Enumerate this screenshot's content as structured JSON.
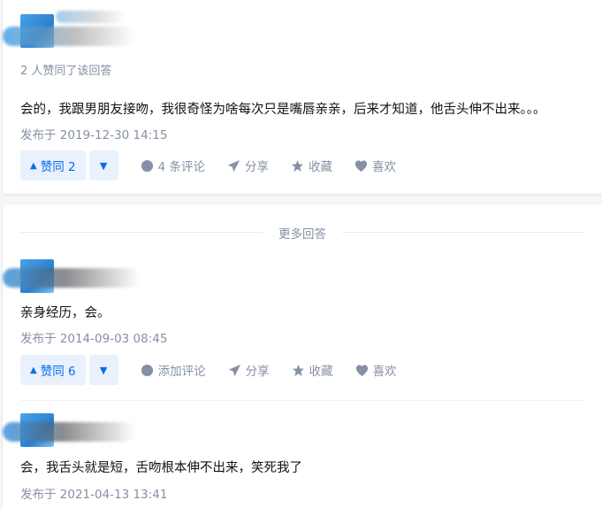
{
  "answers": [
    {
      "votes_note": "2 人赞同了该回答",
      "text": "会的，我跟男朋友接吻，我很奇怪为啥每次只是嘴唇亲亲，后来才知道，他舌头伸不出来。。。",
      "date": "发布于 2019-12-30 14:15",
      "upvote_label": "赞同 2",
      "comment_label": "4 条评论"
    },
    {
      "text": "亲身经历，会。",
      "date": "发布于 2014-09-03 08:45",
      "upvote_label": "赞同 6",
      "comment_label": "添加评论"
    },
    {
      "text": "会，我舌头就是短，舌吻根本伸不出来，笑死我了",
      "date": "发布于 2021-04-13 13:41"
    }
  ],
  "actions": {
    "share": "分享",
    "favorite": "收藏",
    "like": "喜欢",
    "up_arrow": "▲",
    "down_arrow": "▼"
  },
  "more_answers_label": "更多回答",
  "icons": [
    "comment-icon",
    "share-icon",
    "star-icon",
    "heart-icon"
  ],
  "colors": {
    "accent": "#056de8",
    "accent_bg": "#e9f1fd",
    "muted": "#8590a6"
  }
}
